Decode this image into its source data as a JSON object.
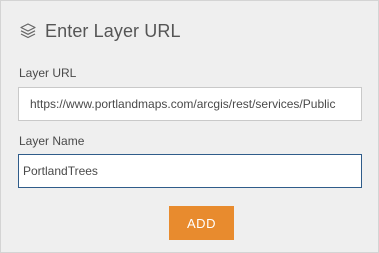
{
  "dialog": {
    "title": "Enter Layer URL",
    "title_icon": "layers-icon"
  },
  "layer_url": {
    "label": "Layer URL",
    "value": "https://www.portlandmaps.com/arcgis/rest/services/Public"
  },
  "layer_name": {
    "label": "Layer Name",
    "value": "PortlandTrees"
  },
  "add_button": {
    "label": "ADD",
    "color": "#e88b2e"
  },
  "colors": {
    "panel_background": "#efefef",
    "active_border": "#2f5c8a"
  }
}
